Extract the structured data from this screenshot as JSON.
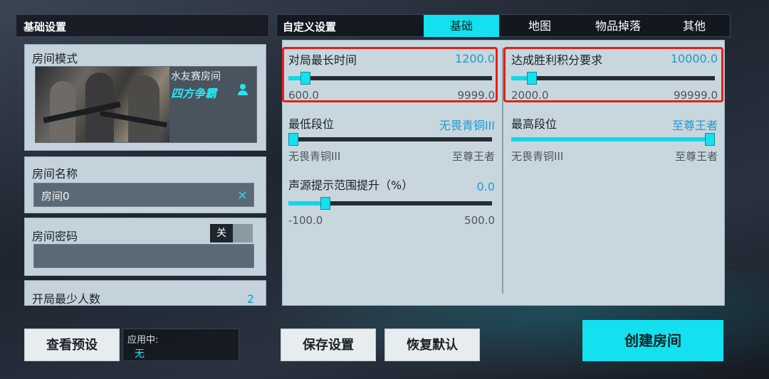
{
  "basic_settings": {
    "header": "基础设置",
    "room_mode": {
      "label": "房间模式",
      "subtitle": "水友赛房间",
      "name": "四方争霸"
    },
    "room_name": {
      "label": "房间名称",
      "value": "房间0"
    },
    "room_password": {
      "label": "房间密码",
      "toggle": "关",
      "value": ""
    },
    "min_players": {
      "label": "开局最少人数",
      "value": "2"
    }
  },
  "custom_settings": {
    "header": "自定义设置",
    "tabs": [
      {
        "label": "基础",
        "active": true
      },
      {
        "label": "地图",
        "active": false
      },
      {
        "label": "物品掉落",
        "active": false
      },
      {
        "label": "其他",
        "active": false
      }
    ],
    "settings": {
      "max_match_time": {
        "label": "对局最长时间",
        "value": "1200.0",
        "min": "600.0",
        "max": "9999.0",
        "fraction": 0.064
      },
      "victory_score": {
        "label": "达成胜利积分要求",
        "value": "10000.0",
        "min": "2000.0",
        "max": "99999.0",
        "fraction": 0.082
      },
      "min_rank": {
        "label": "最低段位",
        "value": "无畏青铜III",
        "min": "无畏青铜III",
        "max": "至尊王者",
        "fraction": 0.0
      },
      "max_rank": {
        "label": "最高段位",
        "value": "至尊王者",
        "min": "无畏青铜III",
        "max": "至尊王者",
        "fraction": 1.0
      },
      "sound_range": {
        "label": "声源提示范围提升（%）",
        "value": "0.0",
        "min": "-100.0",
        "max": "500.0",
        "fraction": 0.167
      }
    }
  },
  "bottom": {
    "view_presets": "查看预设",
    "applying_label": "应用中:",
    "applying_value": "无",
    "save_settings": "保存设置",
    "restore_defaults": "恢复默认",
    "create_room": "创建房间"
  },
  "colors": {
    "accent": "#13E1EF",
    "highlight": "#E2211C",
    "value_blue": "#1E9BD0"
  }
}
